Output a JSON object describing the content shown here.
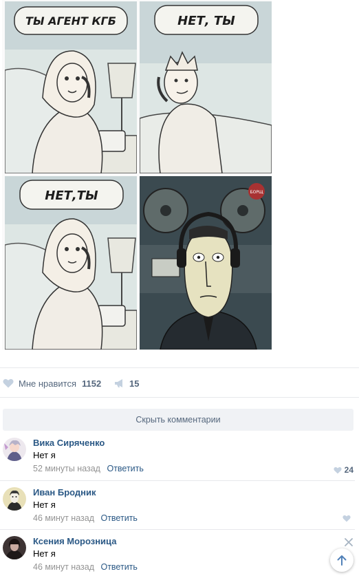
{
  "comic": {
    "panels": [
      {
        "speech": "ТЫ АГЕНТ КГБ"
      },
      {
        "speech": "НЕТ, ТЫ"
      },
      {
        "speech": "НЕТ,ТЫ"
      },
      {
        "speech": ""
      }
    ],
    "watermark": "БОРЩ"
  },
  "actions": {
    "like_label": "Мне нравится",
    "like_count": "1152",
    "share_count": "15"
  },
  "comments_toggle": "Скрыть комментарии",
  "comments": [
    {
      "author": "Вика Сиряченко",
      "text": "Нет я",
      "time": "52 минуты назад",
      "reply": "Ответить",
      "likes": "24"
    },
    {
      "author": "Иван Бродник",
      "text": "Нет я",
      "time": "46 минут назад",
      "reply": "Ответить",
      "likes": ""
    },
    {
      "author": "Ксения Морозница",
      "text": "Нет я",
      "time": "46 минут назад",
      "reply": "Ответить",
      "likes": ""
    }
  ],
  "icons": {
    "like": "heart-icon",
    "share": "megaphone-icon",
    "close": "close-icon",
    "scroll_up": "arrow-up-icon"
  },
  "colors": {
    "link": "#2a5885",
    "muted": "#939393",
    "action": "#55677d",
    "heart": "#c4d1e0"
  }
}
